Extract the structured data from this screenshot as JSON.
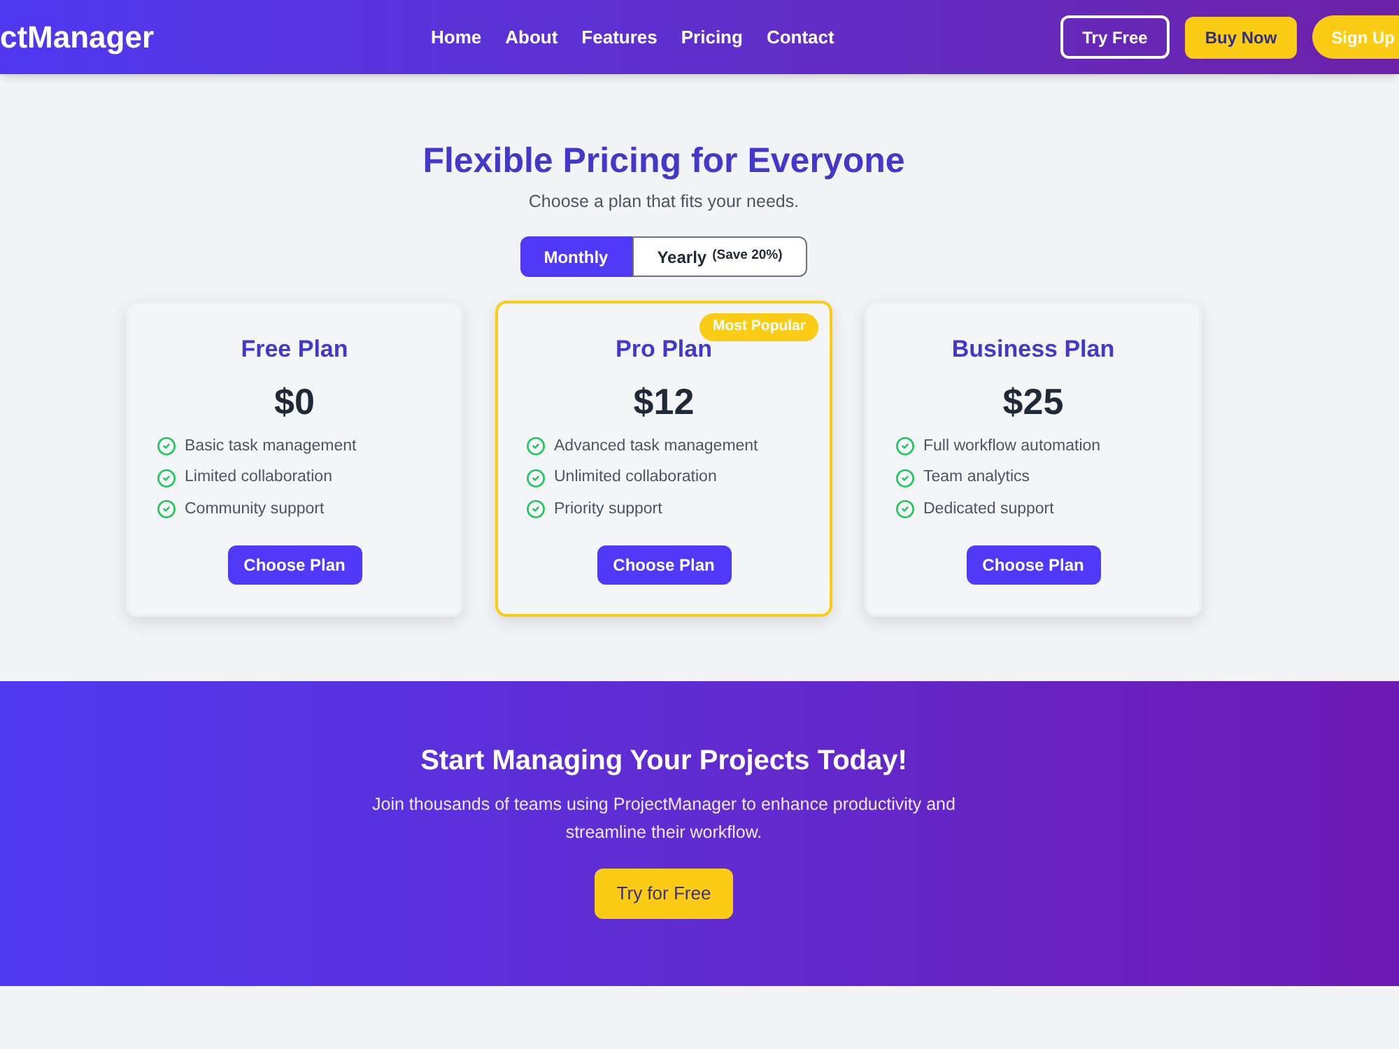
{
  "header": {
    "logo": "ctManager",
    "nav": [
      "Home",
      "About",
      "Features",
      "Pricing",
      "Contact"
    ],
    "actions": [
      {
        "label": "Try Free",
        "kind": "outline"
      },
      {
        "label": "Buy Now",
        "kind": "solid"
      },
      {
        "label": "Sign Up",
        "kind": "pill"
      }
    ]
  },
  "pricing": {
    "title": "Flexible Pricing for Everyone",
    "subtitle": "Choose a plan that fits your needs.",
    "billing_toggle": [
      {
        "label": "Monthly",
        "selected": true
      },
      {
        "label": "Yearly",
        "note": "(Save 20%)",
        "selected": false
      }
    ],
    "plans": [
      {
        "name": "Free Plan",
        "price": "$0",
        "features": [
          "Basic task management",
          "Limited collaboration",
          "Community support"
        ],
        "button": "Choose Plan",
        "highlighted": false
      },
      {
        "name": "Pro Plan",
        "price": "$12",
        "badge": "Most Popular",
        "features": [
          "Advanced task management",
          "Unlimited collaboration",
          "Priority support"
        ],
        "button": "Choose Plan",
        "highlighted": true
      },
      {
        "name": "Business Plan",
        "price": "$25",
        "features": [
          "Full workflow automation",
          "Team analytics",
          "Dedicated support"
        ],
        "button": "Choose Plan",
        "highlighted": false
      }
    ]
  },
  "cta": {
    "title": "Start Managing Your Projects Today!",
    "text": "Join thousands of teams using ProjectManager to enhance productivity and streamline their workflow.",
    "button": "Try for Free"
  }
}
